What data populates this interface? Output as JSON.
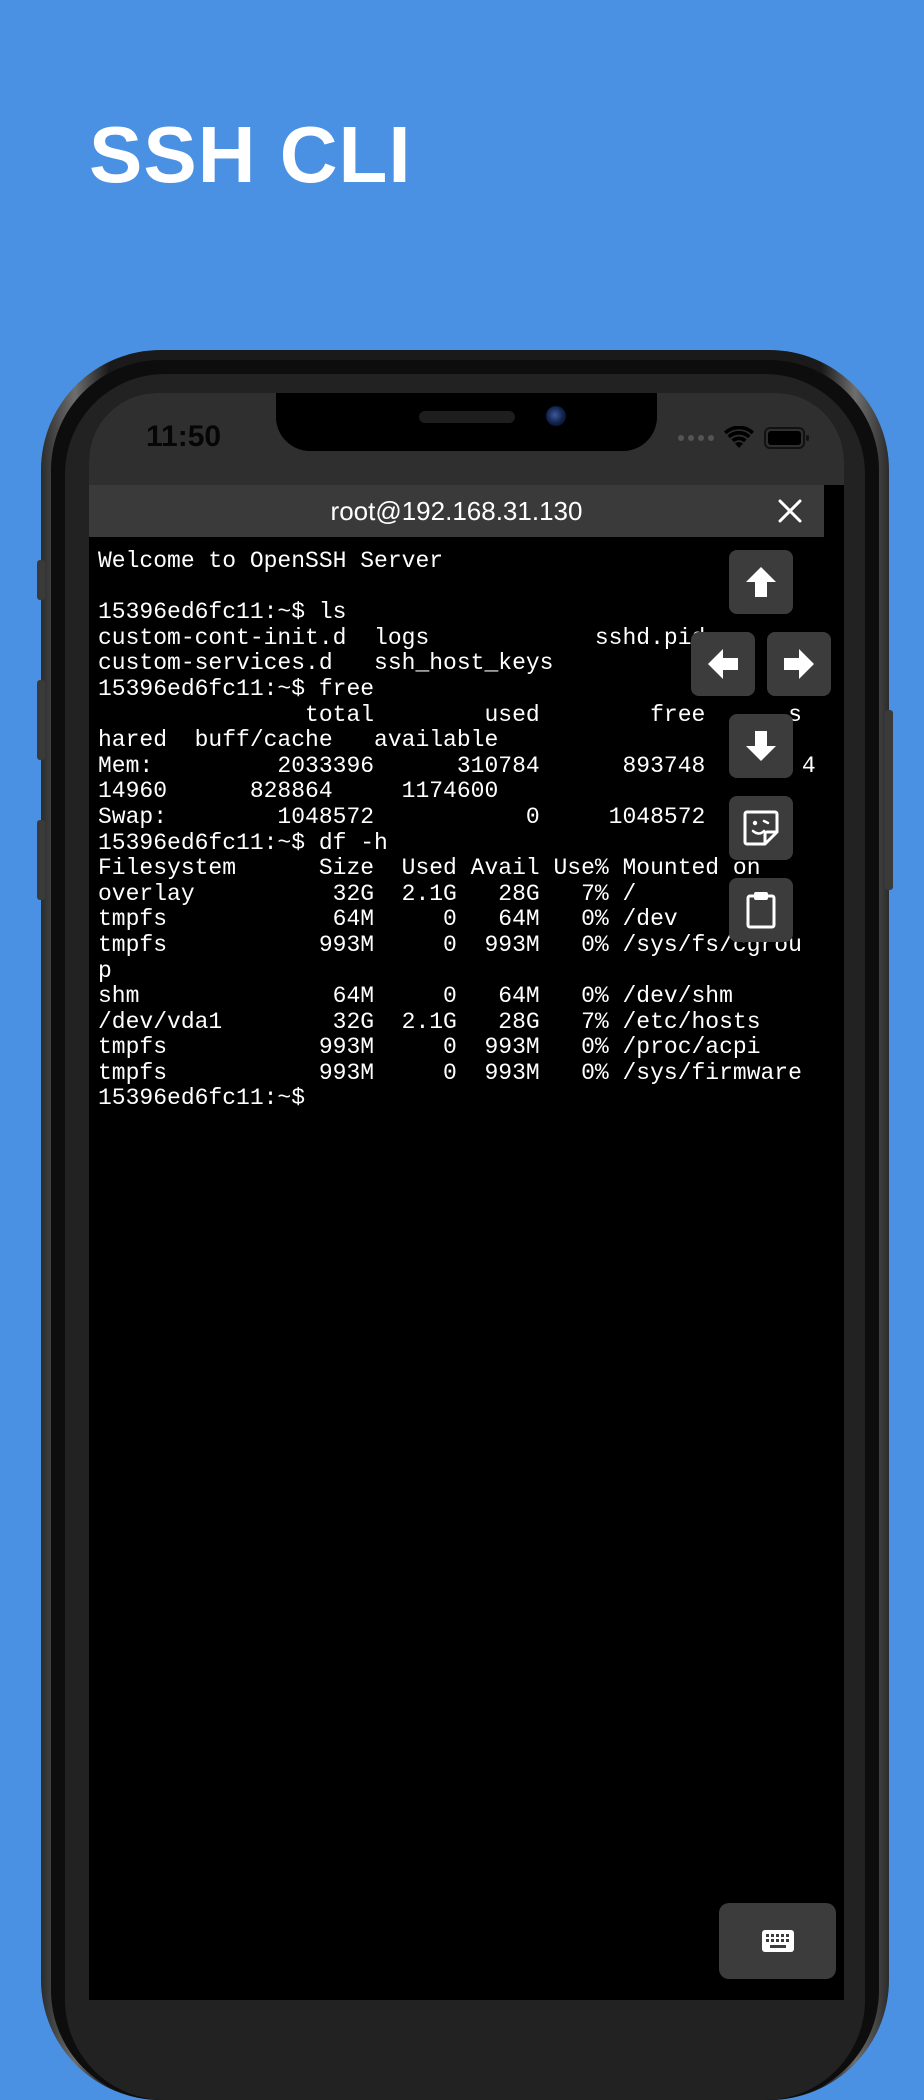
{
  "hero": {
    "title": "SSH CLI"
  },
  "status_bar": {
    "time": "11:50"
  },
  "title_bar": {
    "title": "root@192.168.31.130"
  },
  "terminal": {
    "lines": [
      "Welcome to OpenSSH Server",
      "",
      "15396ed6fc11:~$ ls",
      "custom-cont-init.d  logs            sshd.pid",
      "custom-services.d   ssh_host_keys",
      "15396ed6fc11:~$ free",
      "               total        used        free      s",
      "hared  buff/cache   available",
      "Mem:         2033396      310784      893748       4",
      "14960      828864     1174600",
      "Swap:        1048572           0     1048572",
      "15396ed6fc11:~$ df -h",
      "Filesystem      Size  Used Avail Use% Mounted on",
      "overlay          32G  2.1G   28G   7% /",
      "tmpfs            64M     0   64M   0% /dev",
      "tmpfs           993M     0  993M   0% /sys/fs/cgrou",
      "p",
      "shm              64M     0   64M   0% /dev/shm",
      "/dev/vda1        32G  2.1G   28G   7% /etc/hosts",
      "tmpfs           993M     0  993M   0% /proc/acpi",
      "tmpfs           993M     0  993M   0% /sys/firmware",
      "15396ed6fc11:~$"
    ]
  },
  "controls": {
    "up": "arrow-up-icon",
    "left": "arrow-left-icon",
    "right": "arrow-right-icon",
    "down": "arrow-down-icon",
    "snippet": "sticker-icon",
    "paste": "clipboard-icon",
    "keyboard": "keyboard-icon"
  },
  "colors": {
    "background": "#4a91e4",
    "terminal_bg": "#000000",
    "terminal_fg": "#ffffff",
    "control_bg": "#3c3c3c",
    "titlebar_bg": "#3a3a3a"
  }
}
